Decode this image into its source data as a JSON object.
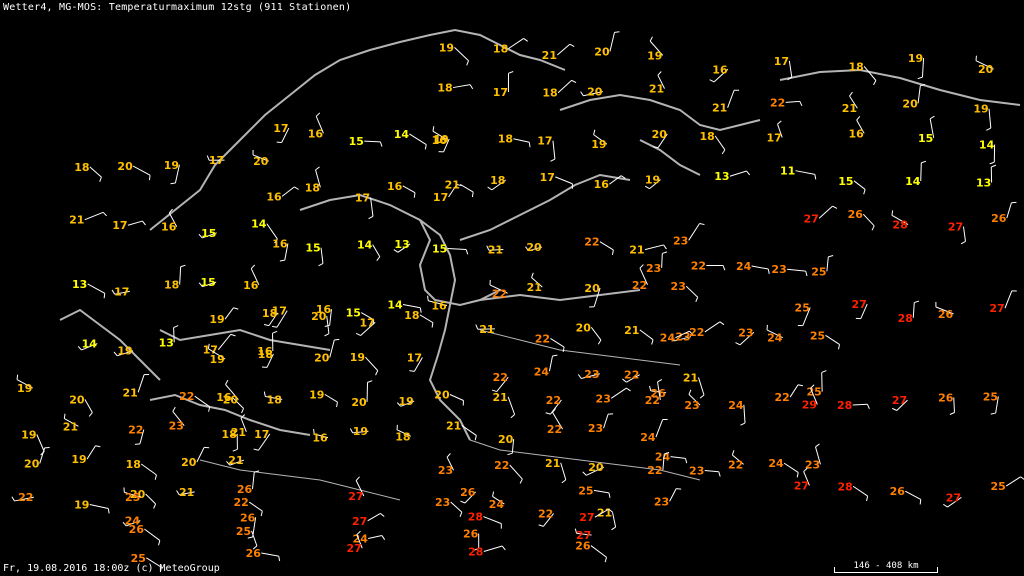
{
  "header": {
    "title": "Wetter4, MG-MOS: Temperaturmaximum 12stg (911 Stationen)"
  },
  "footer": {
    "timestamp": "Fr, 19.08.2016 18:00z (c) MeteoGroup"
  },
  "scale_bar": {
    "label": "146 - 408 km"
  },
  "colors": {
    "background": "#000000",
    "coastline": "#b4b4b4",
    "wind_barb": "#ffffff",
    "cool": "#ffff00",
    "mild": "#ffc000",
    "warm": "#ff8000",
    "hot": "#ff2000"
  },
  "legend_bins": [
    {
      "max": 15,
      "color_key": "cool"
    },
    {
      "max": 21,
      "color_key": "mild"
    },
    {
      "max": 26,
      "color_key": "warm"
    },
    {
      "max": 99,
      "color_key": "hot"
    }
  ],
  "stations_shown": [
    {
      "region": "Norway west coast",
      "values": [
        18,
        20,
        19,
        17,
        20,
        21,
        17,
        16,
        15,
        14,
        13,
        17,
        18,
        15,
        16,
        14,
        19,
        13,
        17,
        16
      ]
    },
    {
      "region": "Central Scandinavia",
      "values": [
        17,
        16,
        15,
        14,
        16,
        16,
        18,
        17,
        16,
        17,
        16,
        15,
        14,
        13,
        15,
        17,
        16,
        15,
        14,
        16
      ]
    },
    {
      "region": "Northern Finland",
      "values": [
        19,
        18,
        21,
        20,
        19,
        18,
        17,
        18,
        20,
        21,
        19,
        18,
        17,
        19,
        20,
        21,
        18,
        17,
        16,
        19
      ]
    },
    {
      "region": "Southern Sweden",
      "values": [
        19,
        18,
        20,
        17,
        18,
        19,
        18,
        20,
        19,
        17,
        16,
        18,
        19,
        20,
        19,
        18,
        17,
        16,
        19,
        18
      ]
    },
    {
      "region": "Baltics",
      "values": [
        21,
        20,
        22,
        21,
        23,
        22,
        21,
        20,
        22,
        23,
        21,
        22,
        20,
        21,
        23,
        22,
        24,
        23,
        22,
        21
      ]
    },
    {
      "region": "Russia west",
      "values": [
        23,
        22,
        24,
        23,
        25,
        24,
        22,
        23,
        24,
        25,
        26,
        23,
        24,
        22,
        25,
        24,
        23,
        22,
        24,
        23
      ]
    },
    {
      "region": "Russia south east",
      "values": [
        27,
        26,
        28,
        27,
        26,
        25,
        27,
        28,
        26,
        27,
        29,
        28,
        27,
        26,
        25,
        27,
        28,
        26,
        27,
        25
      ]
    },
    {
      "region": "Poland Germany",
      "values": [
        20,
        21,
        22,
        23,
        22,
        21,
        20,
        22,
        23,
        24,
        23,
        22,
        21,
        20,
        22,
        23,
        24,
        22,
        21,
        23
      ]
    },
    {
      "region": "Western Europe",
      "values": [
        19,
        20,
        21,
        22,
        20,
        19,
        21,
        22,
        23,
        21,
        20,
        19,
        18,
        20,
        21,
        22,
        19,
        20,
        21,
        22
      ]
    },
    {
      "region": "Southern belt",
      "values": [
        25,
        26,
        27,
        26,
        25,
        24,
        26,
        27,
        28,
        27,
        26,
        25,
        24,
        26,
        27,
        25,
        26,
        27,
        28,
        26
      ]
    },
    {
      "region": "North-west Russia",
      "values": [
        16,
        17,
        18,
        19,
        20,
        21,
        22,
        21,
        20,
        19,
        18,
        17,
        16,
        15,
        14,
        13,
        11,
        15,
        14,
        13
      ]
    }
  ]
}
